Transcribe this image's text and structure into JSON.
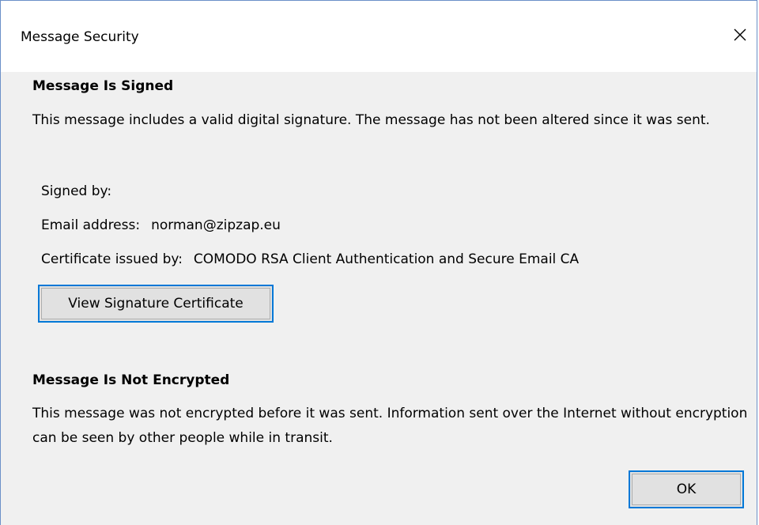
{
  "window": {
    "title": "Message Security",
    "close_icon": "close-icon"
  },
  "signed_section": {
    "heading": "Message Is Signed",
    "description": "This message includes a valid digital signature. The message has not been altered since it was sent.",
    "signed_by_label": "Signed by:",
    "email_label": "Email address:",
    "email_value": "norman@zipzap.eu",
    "issuer_label": "Certificate issued by:",
    "issuer_value": "COMODO RSA Client Authentication and Secure Email CA",
    "view_cert_button": "View Signature Certificate"
  },
  "encryption_section": {
    "heading": "Message Is Not Encrypted",
    "description": "This message was not encrypted before it was sent. Information sent over the Internet without encryption can be seen by other people while in transit."
  },
  "buttons": {
    "ok": "OK"
  },
  "colors": {
    "dialog_bg": "#f0f0f0",
    "focus_border": "#0078d7",
    "button_bg": "#e1e1e1",
    "window_border": "#6b90c8"
  }
}
